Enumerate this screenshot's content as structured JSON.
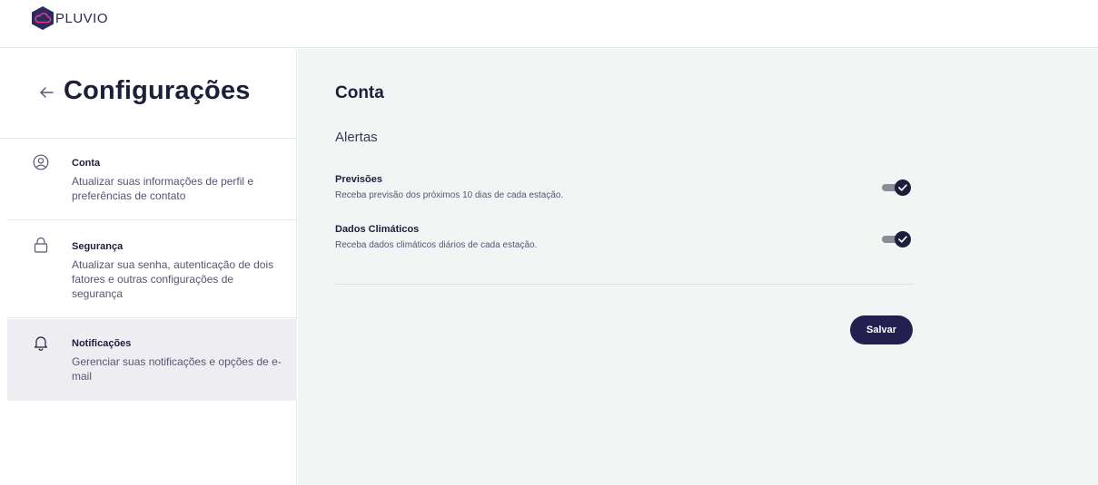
{
  "brand": {
    "name": "PLUVIO",
    "logo_icon": "cloud-hexagon-icon"
  },
  "sidebar": {
    "title": "Configurações",
    "back_icon": "arrow-left-icon",
    "items": [
      {
        "icon": "user-circle-icon",
        "label": "Conta",
        "description": "Atualizar suas informações de perfil e preferências de contato"
      },
      {
        "icon": "lock-icon",
        "label": "Segurança",
        "description": "Atualizar sua senha, autenticação de dois fatores e outras configurações de segurança"
      },
      {
        "icon": "bell-icon",
        "label": "Notificações",
        "description": "Gerenciar suas notificações e opções de e-mail",
        "active": true
      }
    ]
  },
  "main": {
    "title": "Conta",
    "section_title": "Alertas",
    "preferences": [
      {
        "label": "Previsões",
        "description": "Receba previsão dos próximos 10 dias de cada estação.",
        "enabled": true
      },
      {
        "label": "Dados Climáticos",
        "description": "Receba dados climáticos diários de cada estação.",
        "enabled": true
      }
    ],
    "save_label": "Salvar"
  },
  "colors": {
    "primary": "#23204f",
    "main_background": "#f1f6f5",
    "active_item_background": "#eeeef2",
    "logo_fill": "#2b2a63",
    "logo_accent": "#e23b7a"
  }
}
